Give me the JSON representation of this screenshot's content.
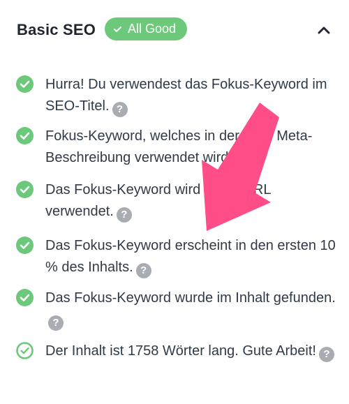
{
  "panel": {
    "title": "Basic SEO",
    "badge_label": "All Good",
    "collapse_icon": "chevron-up-icon"
  },
  "checks": [
    {
      "status": "pass",
      "text": "Hurra! Du verwendest das Fokus-Keyword im SEO-Titel.",
      "help_label": "?"
    },
    {
      "status": "pass",
      "text": "Fokus-Keyword, welches in der SEO Meta-Beschreibung verwendet wird.",
      "help_label": "?"
    },
    {
      "status": "pass",
      "text": "Das Fokus-Keyword wird in der URL verwendet.",
      "help_label": "?"
    },
    {
      "status": "pass",
      "text": "Das Fokus-Keyword erscheint in den ersten 10 % des Inhalts.",
      "help_label": "?"
    },
    {
      "status": "pass",
      "text": "Das Fokus-Keyword wurde im Inhalt gefunden.",
      "help_label": "?"
    },
    {
      "status": "pass-outline",
      "text": "Der Inhalt ist 1758 Wörter lang. Gute Arbeit!",
      "help_label": "?"
    }
  ],
  "colors": {
    "success": "#6cc87a",
    "help_icon": "#a9adb3",
    "annotation_arrow": "#ff4d87"
  }
}
